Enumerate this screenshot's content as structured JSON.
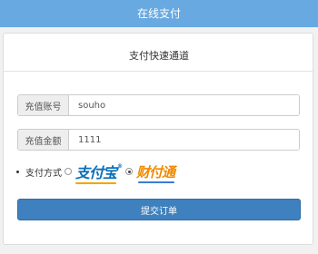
{
  "header": {
    "title": "在线支付"
  },
  "card": {
    "title": "支付快速通道"
  },
  "form": {
    "account": {
      "label": "充值账号",
      "value": "souho"
    },
    "amount": {
      "label": "充值金额",
      "value": "1111"
    },
    "payment": {
      "label": "支付方式",
      "options": [
        {
          "name": "支付宝",
          "mark": "®",
          "selected": false,
          "icon": "alipay-logo",
          "color": "#0b6fb8"
        },
        {
          "name": "财付通",
          "selected": true,
          "icon": "tenpay-logo",
          "color": "#f08a00"
        }
      ]
    },
    "submit_label": "提交订单"
  },
  "colors": {
    "header_bg": "#67a9e0",
    "button_bg": "#3f80be"
  }
}
